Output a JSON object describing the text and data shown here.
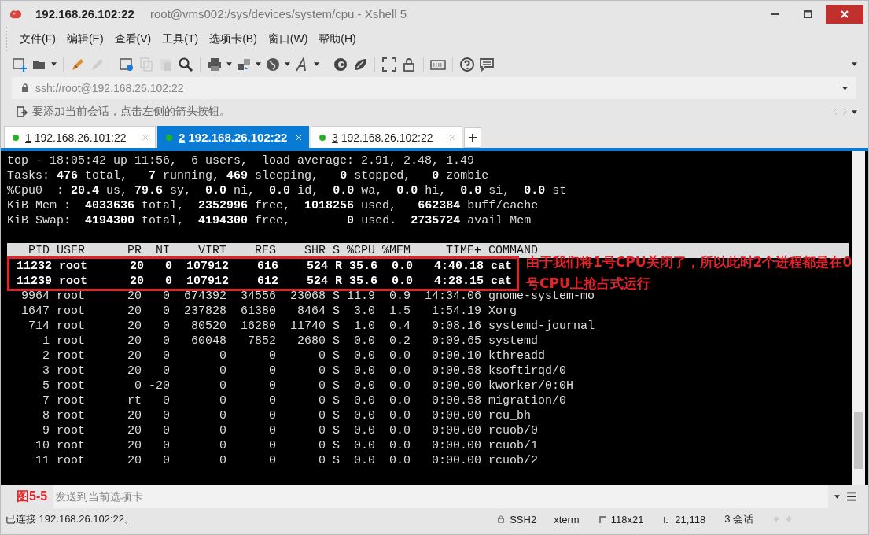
{
  "window": {
    "title": "192.168.26.102:22",
    "subtitle": "root@vms002:/sys/devices/system/cpu - Xshell 5"
  },
  "menu": [
    "文件(F)",
    "编辑(E)",
    "查看(V)",
    "工具(T)",
    "选项卡(B)",
    "窗口(W)",
    "帮助(H)"
  ],
  "address_bar": {
    "value": "ssh://root@192.168.26.102:22"
  },
  "hint_bar": {
    "text": "要添加当前会话，点击左侧的箭头按钮。"
  },
  "tabs": [
    {
      "number": "1",
      "label": "192.168.26.101:22",
      "selected": false
    },
    {
      "number": "2",
      "label": "192.168.26.102:22",
      "selected": true
    },
    {
      "number": "3",
      "label": "192.168.26.102:22",
      "selected": false
    }
  ],
  "terminal": {
    "summary_lines": [
      "top - 18:05:42 up 11:56,  6 users,  load average: 2.91, 2.48, 1.49",
      "Tasks: **476** total,   **7** running, **469** sleeping,   **0** stopped,   **0** zombie",
      "%Cpu0  : **20.4** us, **79.6** sy,  **0.0** ni,  **0.0** id,  **0.0** wa,  **0.0** hi,  **0.0** si,  **0.0** st",
      "KiB Mem :  **4033636** total,  **2352996** free,  **1018256** used,   **662384** buff/cache",
      "KiB Swap:  **4194300** total,  **4194300** free,        **0** used.  **2735724** avail Mem"
    ],
    "columns": [
      "PID",
      "USER",
      "PR",
      "NI",
      "VIRT",
      "RES",
      "SHR",
      "S",
      "%CPU",
      "%MEM",
      "TIME+",
      "COMMAND"
    ],
    "rows": [
      {
        "boxed": true,
        "cells": [
          "11232",
          "root",
          "20",
          "0",
          "107912",
          "616",
          "524",
          "R",
          "35.6",
          "0.0",
          "4:40.18",
          "cat"
        ]
      },
      {
        "boxed": true,
        "cells": [
          "11239",
          "root",
          "20",
          "0",
          "107912",
          "612",
          "524",
          "R",
          "35.6",
          "0.0",
          "4:28.15",
          "cat"
        ]
      },
      {
        "boxed": false,
        "cells": [
          "9964",
          "root",
          "20",
          "0",
          "674392",
          "34556",
          "23068",
          "S",
          "11.9",
          "0.9",
          "14:34.06",
          "gnome-system-mo"
        ]
      },
      {
        "boxed": false,
        "cells": [
          "1647",
          "root",
          "20",
          "0",
          "237828",
          "61380",
          "8464",
          "S",
          "3.0",
          "1.5",
          "1:54.19",
          "Xorg"
        ]
      },
      {
        "boxed": false,
        "cells": [
          "714",
          "root",
          "20",
          "0",
          "80520",
          "16280",
          "11740",
          "S",
          "1.0",
          "0.4",
          "0:08.16",
          "systemd-journal"
        ]
      },
      {
        "boxed": false,
        "cells": [
          "1",
          "root",
          "20",
          "0",
          "60048",
          "7852",
          "2680",
          "S",
          "0.0",
          "0.2",
          "0:09.65",
          "systemd"
        ]
      },
      {
        "boxed": false,
        "cells": [
          "2",
          "root",
          "20",
          "0",
          "0",
          "0",
          "0",
          "S",
          "0.0",
          "0.0",
          "0:00.10",
          "kthreadd"
        ]
      },
      {
        "boxed": false,
        "cells": [
          "3",
          "root",
          "20",
          "0",
          "0",
          "0",
          "0",
          "S",
          "0.0",
          "0.0",
          "0:00.58",
          "ksoftirqd/0"
        ]
      },
      {
        "boxed": false,
        "cells": [
          "5",
          "root",
          "0",
          "-20",
          "0",
          "0",
          "0",
          "S",
          "0.0",
          "0.0",
          "0:00.00",
          "kworker/0:0H"
        ]
      },
      {
        "boxed": false,
        "cells": [
          "7",
          "root",
          "rt",
          "0",
          "0",
          "0",
          "0",
          "S",
          "0.0",
          "0.0",
          "0:00.58",
          "migration/0"
        ]
      },
      {
        "boxed": false,
        "cells": [
          "8",
          "root",
          "20",
          "0",
          "0",
          "0",
          "0",
          "S",
          "0.0",
          "0.0",
          "0:00.00",
          "rcu_bh"
        ]
      },
      {
        "boxed": false,
        "cells": [
          "9",
          "root",
          "20",
          "0",
          "0",
          "0",
          "0",
          "S",
          "0.0",
          "0.0",
          "0:00.00",
          "rcuob/0"
        ]
      },
      {
        "boxed": false,
        "cells": [
          "10",
          "root",
          "20",
          "0",
          "0",
          "0",
          "0",
          "S",
          "0.0",
          "0.0",
          "0:00.00",
          "rcuob/1"
        ]
      },
      {
        "boxed": false,
        "cells": [
          "11",
          "root",
          "20",
          "0",
          "0",
          "0",
          "0",
          "S",
          "0.0",
          "0.0",
          "0:00.00",
          "rcuob/2"
        ]
      }
    ],
    "annotation": "由于我们将1号CPU关闭了，所以此时2个进程都是在0号CPU上抢占式运行"
  },
  "compose_bar": {
    "placeholder": "发送到当前选项卡",
    "figure_label": "图5-5"
  },
  "status_bar": {
    "connection": "已连接 192.168.26.102:22。",
    "protocol": "SSH2",
    "terminal_type": "xterm",
    "size": "118x21",
    "cursor": "21,118",
    "sessions": "3 会话"
  }
}
